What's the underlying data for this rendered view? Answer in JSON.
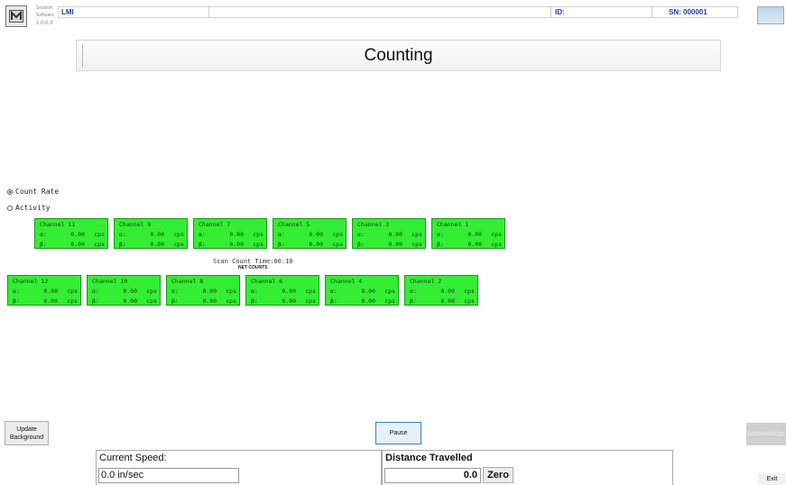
{
  "header": {
    "small_labels": [
      "Session:",
      "Software",
      "1.0.0.X"
    ],
    "session": "LMI",
    "id_label": "ID:",
    "serial": "SN: 000001"
  },
  "title": "Counting",
  "radios": [
    {
      "label": "Count Rate",
      "selected": true
    },
    {
      "label": "Activity",
      "selected": false
    }
  ],
  "channels_top": [
    {
      "name": "Channel 11",
      "alpha": "0.00",
      "beta": "0.00"
    },
    {
      "name": "Channel 9",
      "alpha": "0.00",
      "beta": "0.00"
    },
    {
      "name": "Channel 7",
      "alpha": "0.00",
      "beta": "0.00"
    },
    {
      "name": "Channel 5",
      "alpha": "0.00",
      "beta": "0.00"
    },
    {
      "name": "Channel 3",
      "alpha": "0.00",
      "beta": "0.00"
    },
    {
      "name": "Channel 1",
      "alpha": "0.00",
      "beta": "0.00"
    }
  ],
  "channels_bottom": [
    {
      "name": "Channel 12",
      "alpha": "0.00",
      "beta": "0.00"
    },
    {
      "name": "Channel 10",
      "alpha": "0.00",
      "beta": "0.00"
    },
    {
      "name": "Channel 8",
      "alpha": "0.00",
      "beta": "0.00"
    },
    {
      "name": "Channel 6",
      "alpha": "0.00",
      "beta": "0.00"
    },
    {
      "name": "Channel 4",
      "alpha": "0.00",
      "beta": "0.00"
    },
    {
      "name": "Channel 2",
      "alpha": "0.00",
      "beta": "0.00"
    }
  ],
  "symbols": {
    "alpha": "α:",
    "beta": "β:",
    "unit": "cps"
  },
  "scan_count_time": "Scan Count Time:00:10",
  "net_counts": "NET COUNTS",
  "buttons": {
    "update_background": "Update Background",
    "pause": "Pause",
    "acknowledge": "Acknowledge",
    "exit": "Exit",
    "zero": "Zero"
  },
  "speed": {
    "label": "Current Speed:",
    "value": "0.0 in/sec"
  },
  "distance": {
    "label": "Distance Travelled",
    "value": "0.0"
  },
  "colors": {
    "channel_bg": "#33ee33",
    "accent_text": "#1e3fa8"
  }
}
